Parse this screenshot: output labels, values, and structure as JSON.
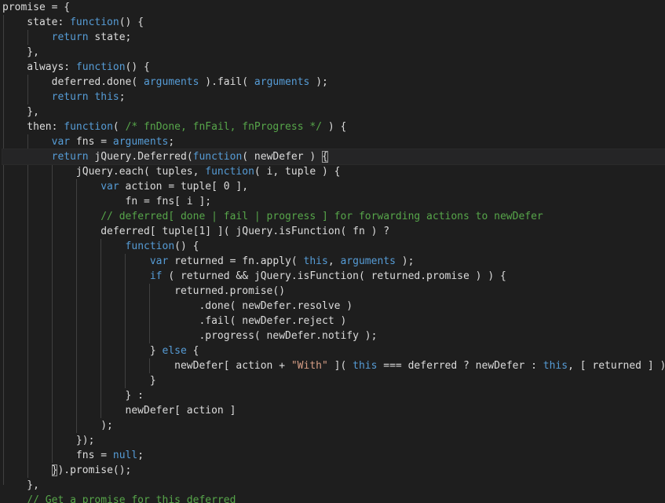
{
  "editor": {
    "language": "javascript",
    "colors": {
      "background": "#1e1e1e",
      "keyword": "#569cd6",
      "comment": "#57a64a",
      "string": "#d69d85",
      "plain": "#dcdcdc"
    },
    "lines": [
      [
        {
          "t": "promise = {",
          "c": "plain"
        }
      ],
      [
        {
          "t": "    state: ",
          "c": "plain"
        },
        {
          "t": "function",
          "c": "keyword"
        },
        {
          "t": "() {",
          "c": "plain"
        }
      ],
      [
        {
          "t": "        ",
          "c": "plain"
        },
        {
          "t": "return",
          "c": "keyword"
        },
        {
          "t": " state;",
          "c": "plain"
        }
      ],
      [
        {
          "t": "    },",
          "c": "plain"
        }
      ],
      [
        {
          "t": "    always: ",
          "c": "plain"
        },
        {
          "t": "function",
          "c": "keyword"
        },
        {
          "t": "() {",
          "c": "plain"
        }
      ],
      [
        {
          "t": "        deferred.done( ",
          "c": "plain"
        },
        {
          "t": "arguments",
          "c": "keyword"
        },
        {
          "t": " ).fail( ",
          "c": "plain"
        },
        {
          "t": "arguments",
          "c": "keyword"
        },
        {
          "t": " );",
          "c": "plain"
        }
      ],
      [
        {
          "t": "        ",
          "c": "plain"
        },
        {
          "t": "return",
          "c": "keyword"
        },
        {
          "t": " ",
          "c": "plain"
        },
        {
          "t": "this",
          "c": "keyword"
        },
        {
          "t": ";",
          "c": "plain"
        }
      ],
      [
        {
          "t": "    },",
          "c": "plain"
        }
      ],
      [
        {
          "t": "    then: ",
          "c": "plain"
        },
        {
          "t": "function",
          "c": "keyword"
        },
        {
          "t": "( ",
          "c": "plain"
        },
        {
          "t": "/* fnDone, fnFail, fnProgress */",
          "c": "comment"
        },
        {
          "t": " ) {",
          "c": "plain"
        }
      ],
      [
        {
          "t": "        ",
          "c": "plain"
        },
        {
          "t": "var",
          "c": "keyword"
        },
        {
          "t": " fns = ",
          "c": "plain"
        },
        {
          "t": "arguments",
          "c": "keyword"
        },
        {
          "t": ";",
          "c": "plain"
        }
      ],
      [
        {
          "t": "        ",
          "c": "plain"
        },
        {
          "t": "return",
          "c": "keyword"
        },
        {
          "t": " jQuery.Deferred(",
          "c": "plain"
        },
        {
          "t": "function",
          "c": "keyword"
        },
        {
          "t": "( newDefer ) ",
          "c": "plain"
        },
        {
          "t": "{",
          "c": "plain",
          "m": 1
        }
      ],
      [
        {
          "t": "            jQuery.each( tuples, ",
          "c": "plain"
        },
        {
          "t": "function",
          "c": "keyword"
        },
        {
          "t": "( i, tuple ) {",
          "c": "plain"
        }
      ],
      [
        {
          "t": "                ",
          "c": "plain"
        },
        {
          "t": "var",
          "c": "keyword"
        },
        {
          "t": " action = tuple[ 0 ],",
          "c": "plain"
        }
      ],
      [
        {
          "t": "                    fn = fns[ i ];",
          "c": "plain"
        }
      ],
      [
        {
          "t": "                ",
          "c": "plain"
        },
        {
          "t": "// deferred[ done | fail | progress ] for forwarding actions to newDefer",
          "c": "comment"
        }
      ],
      [
        {
          "t": "                deferred[ tuple[1] ]( jQuery.isFunction( fn ) ?",
          "c": "plain"
        }
      ],
      [
        {
          "t": "                    ",
          "c": "plain"
        },
        {
          "t": "function",
          "c": "keyword"
        },
        {
          "t": "() {",
          "c": "plain"
        }
      ],
      [
        {
          "t": "                        ",
          "c": "plain"
        },
        {
          "t": "var",
          "c": "keyword"
        },
        {
          "t": " returned = fn.apply( ",
          "c": "plain"
        },
        {
          "t": "this",
          "c": "keyword"
        },
        {
          "t": ", ",
          "c": "plain"
        },
        {
          "t": "arguments",
          "c": "keyword"
        },
        {
          "t": " );",
          "c": "plain"
        }
      ],
      [
        {
          "t": "                        ",
          "c": "plain"
        },
        {
          "t": "if",
          "c": "keyword"
        },
        {
          "t": " ( returned && jQuery.isFunction( returned.promise ) ) {",
          "c": "plain"
        }
      ],
      [
        {
          "t": "                            returned.promise()",
          "c": "plain"
        }
      ],
      [
        {
          "t": "                                .done( newDefer.resolve )",
          "c": "plain"
        }
      ],
      [
        {
          "t": "                                .fail( newDefer.reject )",
          "c": "plain"
        }
      ],
      [
        {
          "t": "                                .progress( newDefer.notify );",
          "c": "plain"
        }
      ],
      [
        {
          "t": "                        } ",
          "c": "plain"
        },
        {
          "t": "else",
          "c": "keyword"
        },
        {
          "t": " {",
          "c": "plain"
        }
      ],
      [
        {
          "t": "                            newDefer[ action + ",
          "c": "plain"
        },
        {
          "t": "\"With\"",
          "c": "string"
        },
        {
          "t": " ]( ",
          "c": "plain"
        },
        {
          "t": "this",
          "c": "keyword"
        },
        {
          "t": " === deferred ? newDefer : ",
          "c": "plain"
        },
        {
          "t": "this",
          "c": "keyword"
        },
        {
          "t": ", [ returned ] );",
          "c": "plain"
        }
      ],
      [
        {
          "t": "                        }",
          "c": "plain"
        }
      ],
      [
        {
          "t": "                    } :",
          "c": "plain"
        }
      ],
      [
        {
          "t": "                    newDefer[ action ]",
          "c": "plain"
        }
      ],
      [
        {
          "t": "                );",
          "c": "plain"
        }
      ],
      [
        {
          "t": "            });",
          "c": "plain"
        }
      ],
      [
        {
          "t": "            fns = ",
          "c": "plain"
        },
        {
          "t": "null",
          "c": "keyword"
        },
        {
          "t": ";",
          "c": "plain"
        }
      ],
      [
        {
          "t": "        ",
          "c": "plain"
        },
        {
          "t": "}",
          "c": "plain",
          "m": 1
        },
        {
          "t": ").promise();",
          "c": "plain"
        }
      ],
      [
        {
          "t": "    },",
          "c": "plain"
        }
      ],
      [
        {
          "t": "    // Get a promise for this deferred",
          "c": "comment"
        }
      ]
    ]
  }
}
